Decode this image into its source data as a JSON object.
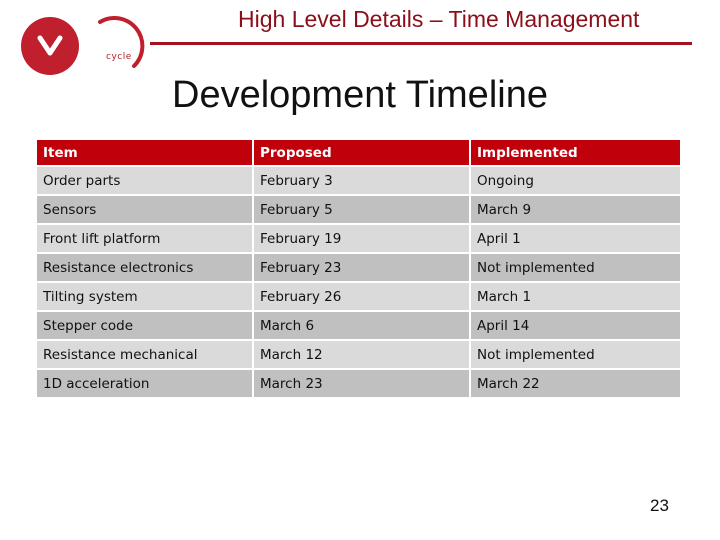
{
  "logo": {
    "text": "cycle",
    "icon": "v-letter-icon",
    "brand_color": "#c0202d"
  },
  "header": {
    "title": "High Level Details – Time Management",
    "accent_color": "#8b0f1a"
  },
  "page": {
    "title": "Development Timeline",
    "number": "23"
  },
  "table": {
    "header_color": "#c0000b",
    "columns": [
      "Item",
      "Proposed",
      "Implemented"
    ],
    "rows": [
      {
        "item": "Order parts",
        "proposed": "February 3",
        "implemented": "Ongoing"
      },
      {
        "item": "Sensors",
        "proposed": "February 5",
        "implemented": "March 9"
      },
      {
        "item": "Front lift platform",
        "proposed": "February 19",
        "implemented": "April 1"
      },
      {
        "item": "Resistance electronics",
        "proposed": "February 23",
        "implemented": "Not implemented"
      },
      {
        "item": "Tilting system",
        "proposed": "February 26",
        "implemented": "March 1"
      },
      {
        "item": "Stepper code",
        "proposed": "March 6",
        "implemented": "April 14"
      },
      {
        "item": "Resistance mechanical",
        "proposed": "March 12",
        "implemented": "Not implemented"
      },
      {
        "item": "1D acceleration",
        "proposed": "March 23",
        "implemented": "March 22"
      }
    ]
  }
}
